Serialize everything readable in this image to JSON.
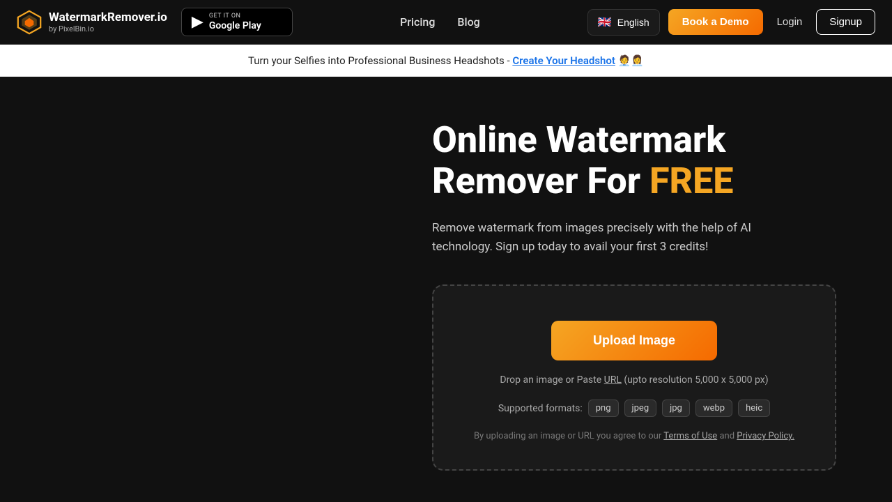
{
  "navbar": {
    "logo_name": "WatermarkRemover.io",
    "logo_sub": "by PixelBin.io",
    "google_play_small": "GET IT ON",
    "google_play_big": "Google Play",
    "pricing_label": "Pricing",
    "blog_label": "Blog",
    "language": "English",
    "flag_emoji": "🇬🇧",
    "book_demo_label": "Book a Demo",
    "login_label": "Login",
    "signup_label": "Signup"
  },
  "announcement": {
    "text": "Turn your Selfies into Professional Business Headshots -",
    "link_text": "Create Your Headshot",
    "emoji": "🧑‍💼👩‍💼"
  },
  "hero": {
    "headline_part1": "Online Watermark",
    "headline_part2": "Remover For ",
    "headline_free": "FREE",
    "subtext": "Remove watermark from images precisely with the help of AI technology. Sign up today to avail your first 3 credits!"
  },
  "upload": {
    "button_label": "Upload Image",
    "drop_text": "Drop an image or Paste",
    "url_label": "URL",
    "resolution_text": "(upto resolution 5,000 x 5,000 px)",
    "formats_label": "Supported formats:",
    "formats": [
      "png",
      "jpeg",
      "jpg",
      "webp",
      "heic"
    ],
    "legal_text": "By uploading an image or URL you agree to our",
    "terms_label": "Terms of Use",
    "and_text": "and",
    "privacy_label": "Privacy Policy."
  },
  "colors": {
    "accent_orange": "#f5a623",
    "accent_orange_dark": "#f56a00"
  }
}
